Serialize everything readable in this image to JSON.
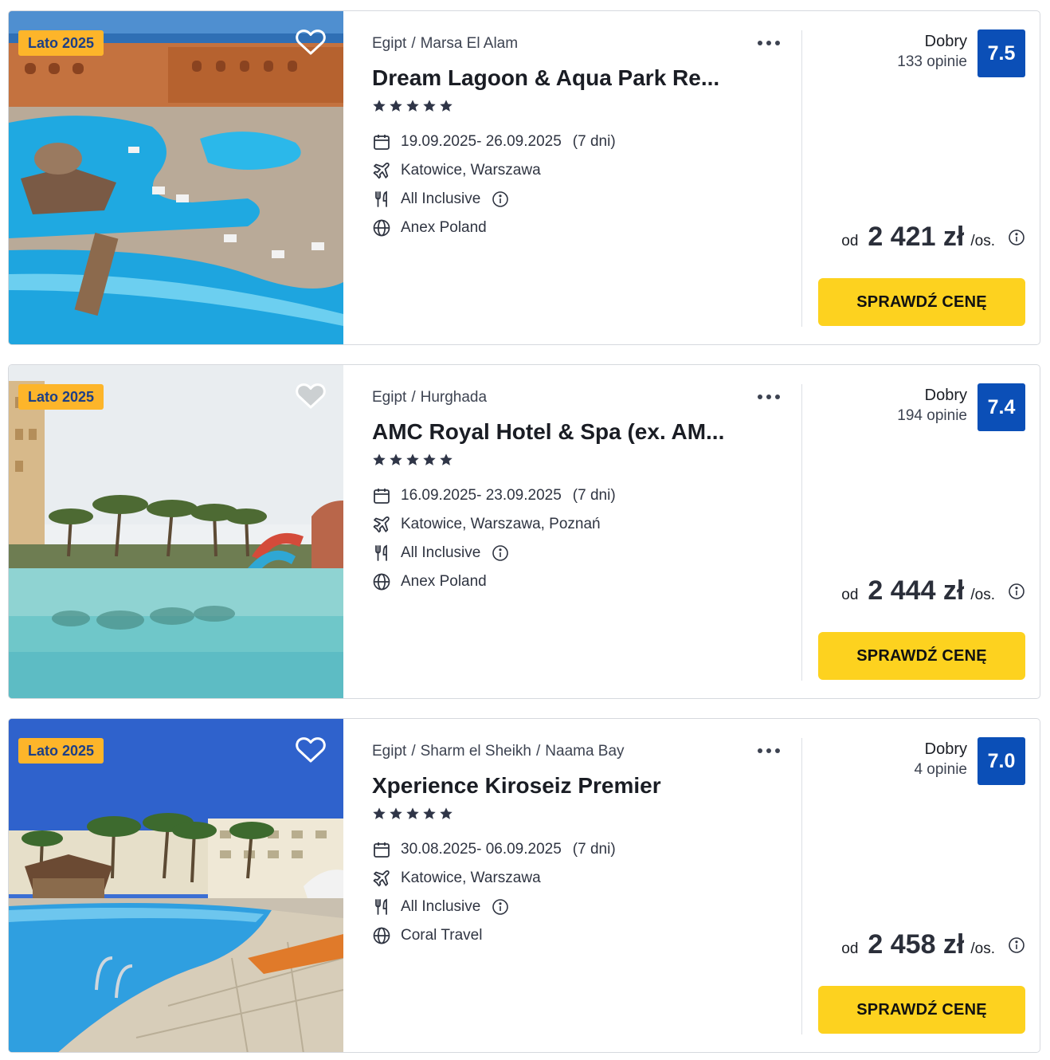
{
  "colors": {
    "badge": "#fdb52a",
    "score": "#0b4fb7",
    "cta": "#fdd21f"
  },
  "offers": [
    {
      "badge": "Lato 2025",
      "breadcrumb": [
        "Egipt",
        "Marsa El Alam"
      ],
      "title": "Dream Lagoon & Aqua Park Re...",
      "stars": 5,
      "dates": "19.09.2025- 26.09.2025",
      "duration": "(7 dni)",
      "departure": "Katowice, Warszawa",
      "board": "All Inclusive",
      "operator": "Anex Poland",
      "rating_label": "Dobry",
      "reviews": "133 opinie",
      "score": "7.5",
      "price_prefix": "od",
      "price": "2 421 zł",
      "price_unit": "/os.",
      "cta": "SPRAWDŹ CENĘ",
      "favorite_icon": "heart-outline-icon"
    },
    {
      "badge": "Lato 2025",
      "breadcrumb": [
        "Egipt",
        "Hurghada"
      ],
      "title": "AMC Royal Hotel & Spa (ex. AM...",
      "stars": 5,
      "dates": "16.09.2025- 23.09.2025",
      "duration": "(7 dni)",
      "departure": "Katowice, Warszawa, Poznań",
      "board": "All Inclusive",
      "operator": "Anex Poland",
      "rating_label": "Dobry",
      "reviews": "194 opinie",
      "score": "7.4",
      "price_prefix": "od",
      "price": "2 444 zł",
      "price_unit": "/os.",
      "cta": "SPRAWDŹ CENĘ",
      "favorite_icon": "heart-outline-icon"
    },
    {
      "badge": "Lato 2025",
      "breadcrumb": [
        "Egipt",
        "Sharm el Sheikh",
        "Naama Bay"
      ],
      "title": "Xperience Kiroseiz Premier",
      "stars": 5,
      "dates": "30.08.2025- 06.09.2025",
      "duration": "(7 dni)",
      "departure": "Katowice, Warszawa",
      "board": "All Inclusive",
      "operator": "Coral Travel",
      "rating_label": "Dobry",
      "reviews": "4 opinie",
      "score": "7.0",
      "price_prefix": "od",
      "price": "2 458 zł",
      "price_unit": "/os.",
      "cta": "SPRAWDŹ CENĘ",
      "favorite_icon": "heart-outline-icon"
    }
  ]
}
